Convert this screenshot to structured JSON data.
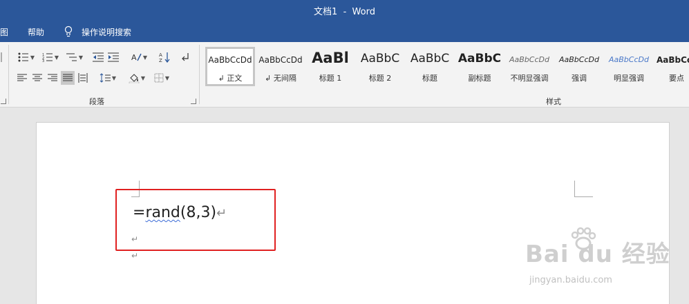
{
  "window": {
    "title": "文档1  -  Word"
  },
  "menu": {
    "items": [
      "图",
      "帮助"
    ],
    "tell_me": "操作说明搜索"
  },
  "ribbon": {
    "paragraph_group_label": "段落",
    "styles_group_label": "样式",
    "styles": [
      {
        "preview": "AaBbCcDd",
        "name": "↲ 正文"
      },
      {
        "preview": "AaBbCcDd",
        "name": "↲ 无间隔"
      },
      {
        "preview": "AaBl",
        "name": "标题 1"
      },
      {
        "preview": "AaBbC",
        "name": "标题 2"
      },
      {
        "preview": "AaBbC",
        "name": "标题"
      },
      {
        "preview": "AaBbC",
        "name": "副标题"
      },
      {
        "preview": "AaBbCcDd",
        "name": "不明显强调"
      },
      {
        "preview": "AaBbCcDd",
        "name": "强调"
      },
      {
        "preview": "AaBbCcDd",
        "name": "明显强调"
      },
      {
        "preview": "AaBbCc",
        "name": "要点"
      }
    ]
  },
  "document": {
    "formula_prefix": "=",
    "formula_func": "rand",
    "formula_args": "(8,3)",
    "mark": "↵"
  },
  "watermark": {
    "brand": "Bai du 经验",
    "url": "jingyan.baidu.com"
  },
  "colors": {
    "titlebar": "#2b579a",
    "highlight_box": "#e02020",
    "emphasis_blue": "#4a78c8"
  }
}
